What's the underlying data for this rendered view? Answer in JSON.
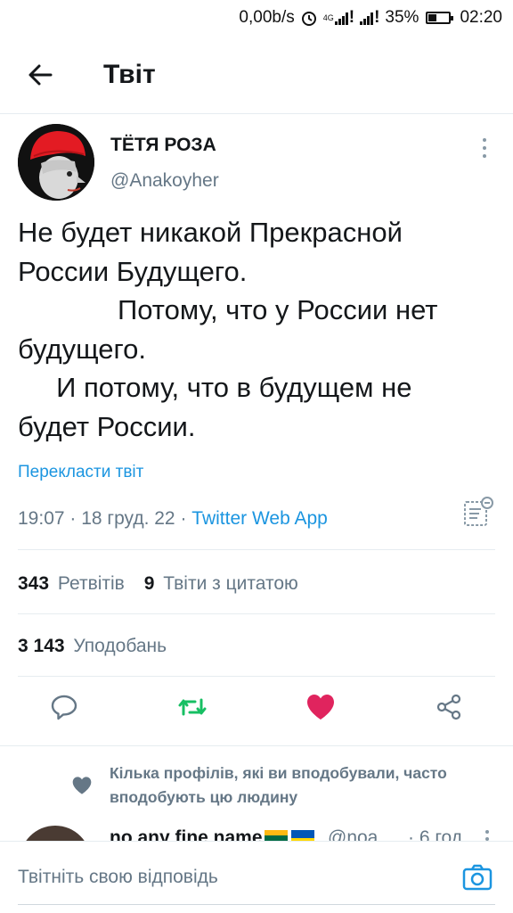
{
  "status_bar": {
    "speed": "0,00b/s",
    "network": "4G",
    "battery": "35%",
    "time": "02:20"
  },
  "header": {
    "title": "Твіт"
  },
  "tweet": {
    "author_name": "ТЁТЯ РОЗА",
    "author_handle": "@Anakoyher",
    "text": "Не будет никакой Прекрасной\nРоссии Будущего.\n             Потому, что у России нет\nбудущего.\n     И потому, что в будущем не\nбудет России.",
    "translate_label": "Перекласти твіт",
    "time": "19:07",
    "date": "18 груд. 22",
    "source": "Twitter Web App",
    "retweets_count": "343",
    "retweets_label": "Ретвітів",
    "quotes_count": "9",
    "quotes_label": "Твіти з цитатою",
    "likes_count": "3 143",
    "likes_label": "Уподобань"
  },
  "suggestion": {
    "text": "Кілька профілів, які ви вподобували, часто вподобують цю людину",
    "next_name": "no any fine name",
    "next_handle": "@noa",
    "next_time": "· 6 год"
  },
  "reply": {
    "placeholder": "Твітніть свою відповідь"
  },
  "colors": {
    "link": "#1b95e0",
    "secondary_text": "#657786",
    "retweet_green": "#17bf63",
    "like_pink": "#e0245e",
    "avatar_turban_red": "#e31b23"
  },
  "icons": {
    "back": "arrow-left-icon",
    "more": "more-vertical-icon",
    "analytics": "analytics-icon",
    "reply": "reply-icon",
    "retweet": "retweet-icon",
    "like": "heart-icon",
    "share": "share-icon",
    "camera": "camera-icon"
  }
}
